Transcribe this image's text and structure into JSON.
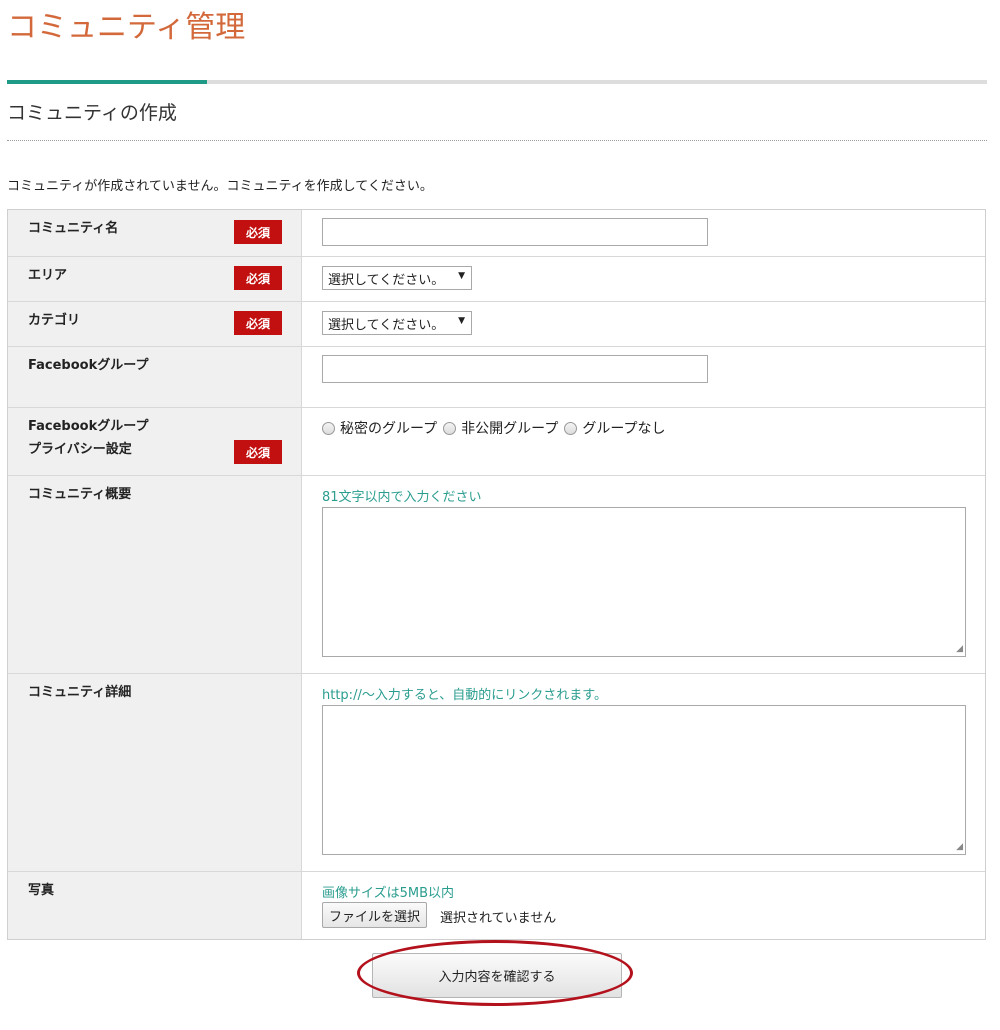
{
  "header": {
    "page_title": "コミュニティ管理",
    "section_title": "コミュニティの作成",
    "intro": "コミュニティが作成されていません。コミュニティを作成してください。",
    "accent_color": "#1f9a86",
    "title_color": "#d3683a"
  },
  "required_badge": "必須",
  "form": {
    "community_name": {
      "label": "コミュニティ名",
      "value": ""
    },
    "area": {
      "label": "エリア",
      "selected": "選択してください。"
    },
    "category": {
      "label": "カテゴリ",
      "selected": "選択してください。"
    },
    "facebook_group": {
      "label": "Facebookグループ",
      "value": ""
    },
    "privacy": {
      "label_line1": "Facebookグループ",
      "label_line2": "プライバシー設定",
      "options": [
        "秘密のグループ",
        "非公開グループ",
        "グループなし"
      ]
    },
    "summary": {
      "label": "コミュニティ概要",
      "hint": "81文字以内で入力ください",
      "value": ""
    },
    "detail": {
      "label": "コミュニティ詳細",
      "hint": "http://～入力すると、自動的にリンクされます。",
      "value": ""
    },
    "photo": {
      "label": "写真",
      "hint": "画像サイズは5MB以内",
      "file_button": "ファイルを選択",
      "file_status": "選択されていません"
    }
  },
  "confirm_button": "入力内容を確認する",
  "highlight_color": "#b3111c",
  "required_color": "#c20f0f"
}
